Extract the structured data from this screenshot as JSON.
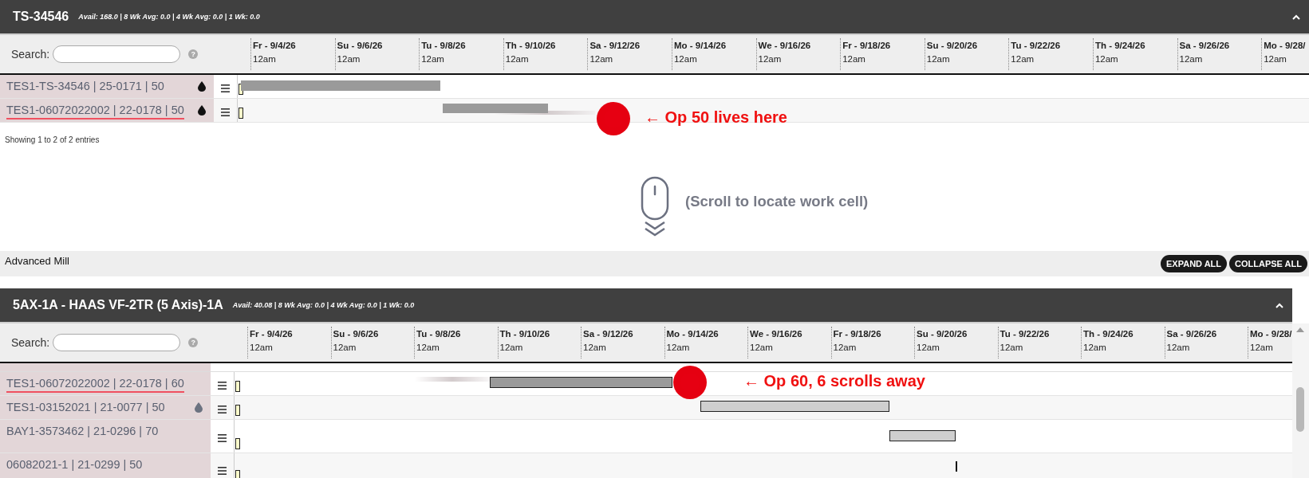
{
  "top_panel": {
    "title": "TS-34546",
    "stats": "Avail: 168.0 | 8 Wk Avg: 0.0 | 4 Wk Avg: 0.0 | 1 Wk: 0.0",
    "search_label": "Search:",
    "help": "?",
    "dates": [
      {
        "day": "Fr - 9/4/26",
        "time": "12am"
      },
      {
        "day": "Su - 9/6/26",
        "time": "12am"
      },
      {
        "day": "Tu - 9/8/26",
        "time": "12am"
      },
      {
        "day": "Th - 9/10/26",
        "time": "12am"
      },
      {
        "day": "Sa - 9/12/26",
        "time": "12am"
      },
      {
        "day": "Mo - 9/14/26",
        "time": "12am"
      },
      {
        "day": "We - 9/16/26",
        "time": "12am"
      },
      {
        "day": "Fr - 9/18/26",
        "time": "12am"
      },
      {
        "day": "Su - 9/20/26",
        "time": "12am"
      },
      {
        "day": "Tu - 9/22/26",
        "time": "12am"
      },
      {
        "day": "Th - 9/24/26",
        "time": "12am"
      },
      {
        "day": "Sa - 9/26/26",
        "time": "12am"
      },
      {
        "day": "Mo - 9/28/",
        "time": "12am"
      }
    ],
    "rows": [
      {
        "label": "TES1-TS-34546 | 25-0171 | 50",
        "highlighted": false,
        "color": "#111111"
      },
      {
        "label": "TES1-06072022002 | 22-0178 | 50",
        "highlighted": true,
        "color": "#111111",
        "callout": "← Op 50 lives here"
      }
    ],
    "footer": "Showing 1 to 2 of 2 entries"
  },
  "scroll_hint": "(Scroll to locate work cell)",
  "group_bar": {
    "title": "Advanced Mill",
    "buttons": [
      "EXPAND ALL",
      "COLLAPSE ALL"
    ]
  },
  "bottom_panel": {
    "title": "5AX-1A - HAAS VF-2TR (5 Axis)-1A",
    "stats": "Avail: 40.08 | 8 Wk Avg: 0.0 | 4 Wk Avg: 0.0 | 1 Wk: 0.0",
    "search_label": "Search:",
    "help": "?",
    "dates": [
      {
        "day": "Fr - 9/4/26",
        "time": "12am"
      },
      {
        "day": "Su - 9/6/26",
        "time": "12am"
      },
      {
        "day": "Tu - 9/8/26",
        "time": "12am"
      },
      {
        "day": "Th - 9/10/26",
        "time": "12am"
      },
      {
        "day": "Sa - 9/12/26",
        "time": "12am"
      },
      {
        "day": "Mo - 9/14/26",
        "time": "12am"
      },
      {
        "day": "We - 9/16/26",
        "time": "12am"
      },
      {
        "day": "Fr - 9/18/26",
        "time": "12am"
      },
      {
        "day": "Su - 9/20/26",
        "time": "12am"
      },
      {
        "day": "Tu - 9/22/26",
        "time": "12am"
      },
      {
        "day": "Th - 9/24/26",
        "time": "12am"
      },
      {
        "day": "Sa - 9/26/26",
        "time": "12am"
      },
      {
        "day": "Mo - 9/28/",
        "time": "12am"
      }
    ],
    "rows": [
      {
        "label": "TES1-06072022002 | 22-0178 | 60",
        "highlighted": true,
        "callout": "← Op 60, 6 scrolls away"
      },
      {
        "label": "TES1-03152021 | 21-0077 | 50",
        "highlighted": false,
        "color": "#6b7280"
      },
      {
        "label": "BAY1-3573462 | 21-0296 | 70",
        "highlighted": false
      },
      {
        "label": "06082021-1 | 21-0299 | 50",
        "highlighted": false
      }
    ]
  }
}
